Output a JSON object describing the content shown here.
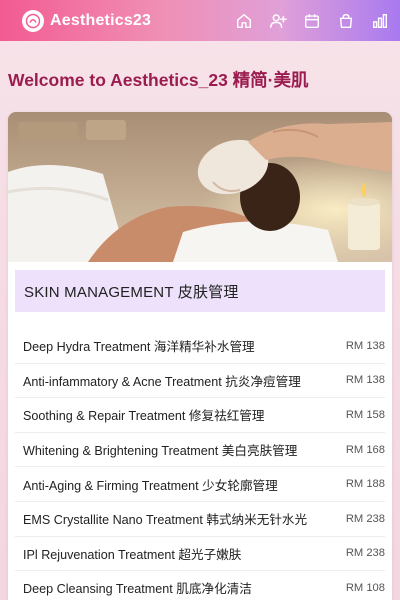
{
  "header": {
    "brand": "Aesthetics23",
    "nav": [
      {
        "icon": "home-icon"
      },
      {
        "icon": "add-user-icon"
      },
      {
        "icon": "calendar-icon"
      },
      {
        "icon": "shopping-bag-icon"
      },
      {
        "icon": "bar-chart-icon"
      }
    ]
  },
  "welcome": "Welcome to Aesthetics_23 精简·美肌",
  "hero_image": "facial-treatment-photo",
  "section": {
    "title": "SKIN MANAGEMENT 皮肤管理",
    "items": [
      {
        "name": "Deep Hydra Treatment 海洋精华补水管理",
        "price": "RM 138"
      },
      {
        "name": "Anti-infammatory & Acne Treatment 抗炎净痘管理",
        "price": "RM 138"
      },
      {
        "name": "Soothing & Repair Treatment 修复祛红管理",
        "price": "RM 158"
      },
      {
        "name": "Whitening & Brightening Treatment 美白亮肤管理",
        "price": "RM 168"
      },
      {
        "name": "Anti-Aging & Firming Treatment 少女轮廓管理",
        "price": "RM 188"
      },
      {
        "name": "EMS Crystallite Nano Treatment 韩式纳米无针水光",
        "price": "RM 238"
      },
      {
        "name": "IPl Rejuvenation Treatment 超光子嫩肤",
        "price": "RM 238"
      },
      {
        "name": "Deep Cleansing Treatment 肌底净化清洁",
        "price": "RM 108"
      }
    ]
  },
  "colors": {
    "welcome": "#9b1d4f",
    "section_bg": "#ede1fb",
    "header_start": "#f25b92",
    "header_end": "#a87af0"
  }
}
